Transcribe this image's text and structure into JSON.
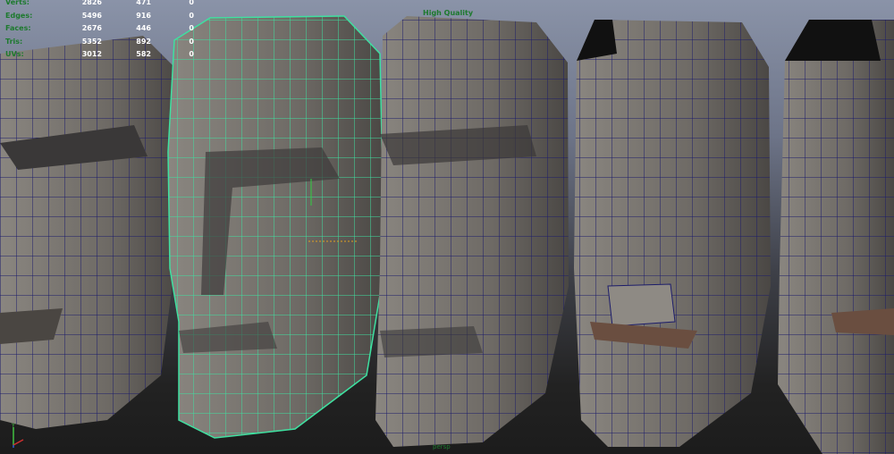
{
  "hud": {
    "rows": [
      {
        "label": "Verts:",
        "total": "2826",
        "selected": "471",
        "extra": "0"
      },
      {
        "label": "Edges:",
        "total": "5496",
        "selected": "916",
        "extra": "0"
      },
      {
        "label": "Faces:",
        "total": "2676",
        "selected": "446",
        "extra": "0"
      },
      {
        "label": "Tris:",
        "total": "5352",
        "selected": "892",
        "extra": "0"
      },
      {
        "label": "UVs:",
        "total": "3012",
        "selected": "582",
        "extra": "0"
      }
    ]
  },
  "viewport": {
    "quality_label": "High Quality",
    "camera_label": "persp",
    "colors": {
      "hud_label": "#1d7a2e",
      "selection_wire": "#3fe0a0",
      "wire": "#1c1c6a",
      "mesh": "#77736d"
    }
  }
}
